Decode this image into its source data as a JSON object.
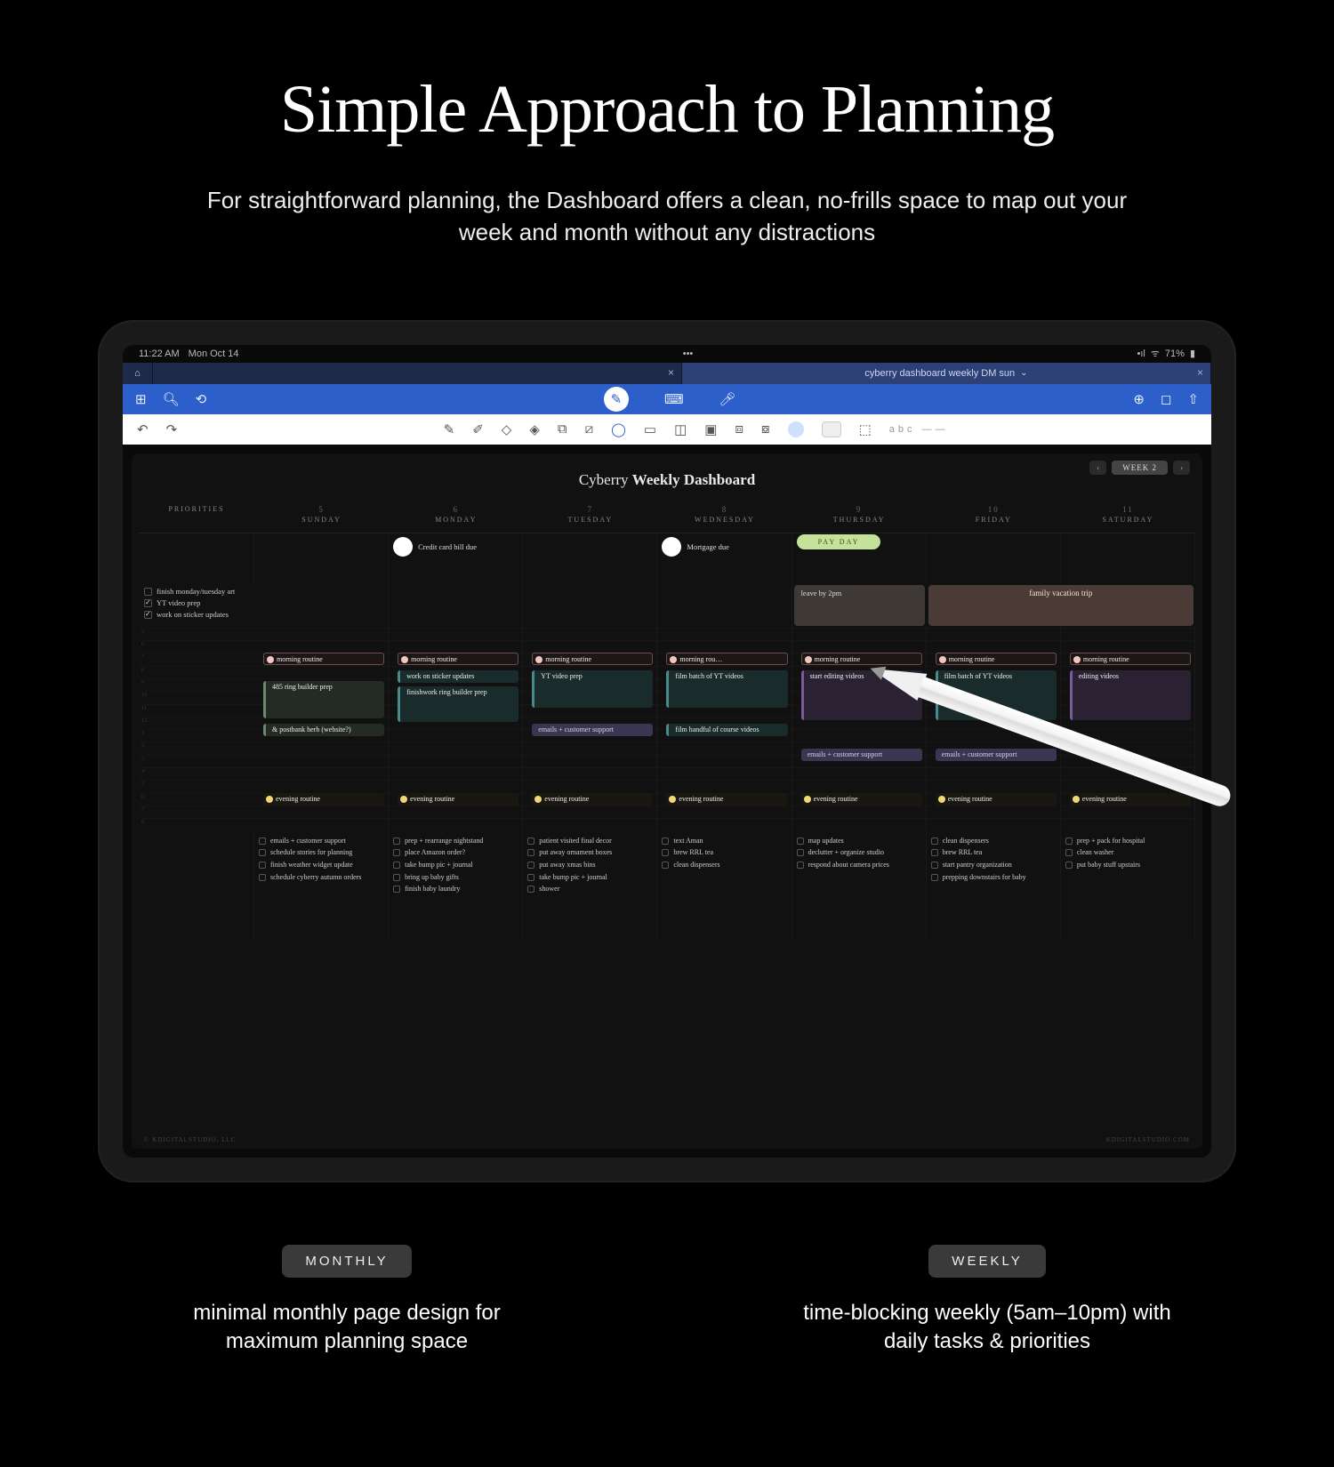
{
  "headline": "Simple Approach to Planning",
  "subhead": "For straightforward planning, the Dashboard offers a clean, no-frills space to map out your week and month without any distractions",
  "status": {
    "time": "11:22 AM",
    "date": "Mon Oct 14",
    "battery": "71%"
  },
  "tabs": {
    "left_blank": "",
    "right_label": "cyberry dashboard weekly DM sun"
  },
  "planner": {
    "title_light": "Cyberry",
    "title_bold": "Weekly Dashboard",
    "week_label": "WEEK 2",
    "priorities_header": "PRIORITIES",
    "days": [
      {
        "num": "5",
        "name": "SUNDAY"
      },
      {
        "num": "6",
        "name": "MONDAY"
      },
      {
        "num": "7",
        "name": "TUESDAY"
      },
      {
        "num": "8",
        "name": "WEDNESDAY"
      },
      {
        "num": "9",
        "name": "THURSDAY"
      },
      {
        "num": "10",
        "name": "FRIDAY"
      },
      {
        "num": "11",
        "name": "SATURDAY"
      }
    ],
    "top_events": {
      "mon": "Credit card bill due",
      "wed": "Mortgage due",
      "thu_payday": "PAY DAY"
    },
    "strips": {
      "leave": "leave by 2pm",
      "vacation": "family vacation trip"
    },
    "priorities": [
      {
        "done": false,
        "text": "finish monday/tuesday art"
      },
      {
        "done": true,
        "text": "YT video prep"
      },
      {
        "done": true,
        "text": "work on sticker updates"
      }
    ],
    "morning_label": "morning routine",
    "morning_label_short": "morning rou…",
    "evening_label": "evening routine",
    "blocks": {
      "sun": [
        "485 ring builder prep",
        "",
        "& postbank herb (website?)"
      ],
      "mon": [
        "work on sticker updates",
        "finishwork ring builder prep"
      ],
      "tue": [
        "YT video prep"
      ],
      "tue_emails": "emails + customer support",
      "wed": [
        "film batch of YT videos",
        "",
        "film handful of course videos"
      ],
      "thu": [
        "start editing videos"
      ],
      "thu_emails": "emails + customer support",
      "fri": [
        "film batch of YT videos"
      ],
      "fri_emails": "emails + customer support",
      "sat": [
        "editing videos"
      ]
    },
    "tasks": {
      "sun": [
        "emails + customer support",
        "schedule stories for planning",
        "finish weather widget update",
        "schedule cyberry autumn orders"
      ],
      "mon": [
        "prep + rearrange nightstand",
        "place Amazon order?",
        "take bump pic + journal",
        "bring up baby gifts",
        "finish baby laundry"
      ],
      "tue": [
        "patient visited final decor",
        "put away ornament boxes",
        "put away xmas bins",
        "take bump pic + journal",
        "shower"
      ],
      "wed": [
        "text Aman",
        "brew RRL tea",
        "clean dispensers"
      ],
      "thu": [
        "map updates",
        "declutter + organize studio",
        "respond about camera prices"
      ],
      "fri": [
        "clean dispensers",
        "brew RRL tea",
        "start pantry organization",
        "prepping downstairs for baby"
      ],
      "sat": [
        "prep + pack for hospital",
        "clean washer",
        "put baby stuff upstairs"
      ]
    },
    "footer_left": "© KDIGITALSTUDIO, LLC",
    "footer_right": "KDIGITALSTUDIO.COM"
  },
  "bottom": {
    "monthly_chip": "MONTHLY",
    "monthly_text": "minimal monthly page design for maximum planning space",
    "weekly_chip": "WEEKLY",
    "weekly_text": "time-blocking weekly (5am–10pm) with daily tasks & priorities"
  }
}
